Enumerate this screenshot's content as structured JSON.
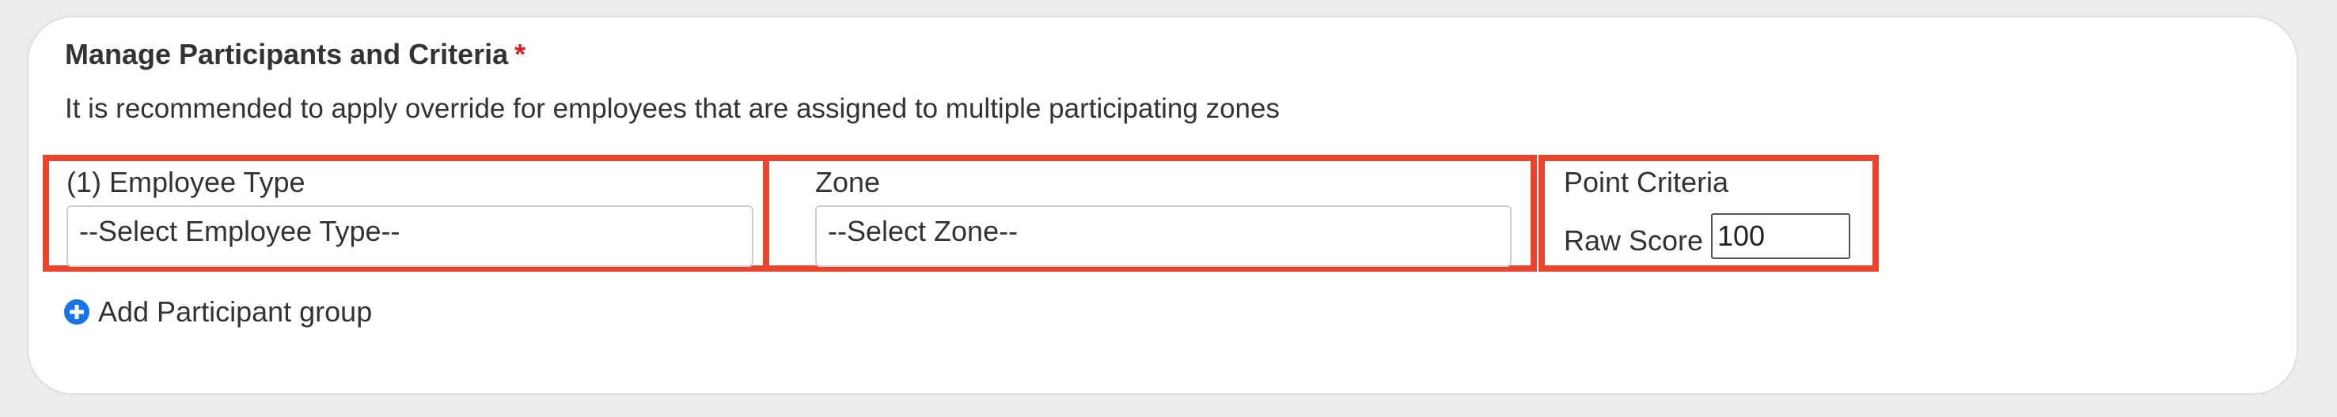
{
  "section": {
    "title": "Manage Participants and Criteria",
    "required_marker": "*",
    "hint": "It is recommended to apply override for employees that are assigned to multiple participating zones"
  },
  "columns": {
    "employee_type": {
      "label": "(1) Employee Type",
      "selected": "--Select Employee Type--"
    },
    "zone": {
      "label": "Zone",
      "selected": "--Select Zone--"
    },
    "point_criteria": {
      "label": "Point Criteria",
      "raw_score_label": "Raw Score",
      "raw_score_value": "100"
    }
  },
  "actions": {
    "add_participant_group": "Add Participant group",
    "add_icon": "plus-circle-icon"
  },
  "colors": {
    "highlight_border": "#e8452c",
    "required": "#e02020",
    "accent_icon": "#1a73e8"
  }
}
